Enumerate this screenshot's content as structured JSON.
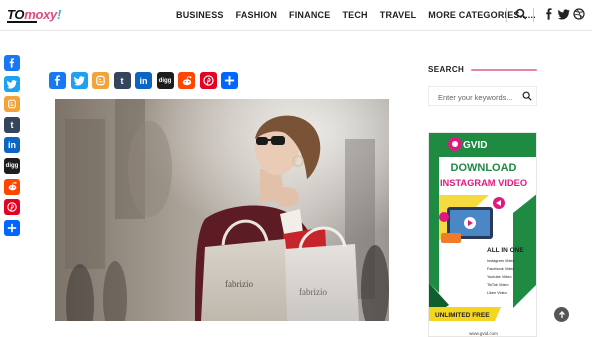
{
  "brand": {
    "logo_part1": "TO",
    "logo_part2": "moxy",
    "logo_part3": "!"
  },
  "nav": {
    "items": [
      "BUSINESS",
      "FASHION",
      "FINANCE",
      "TECH",
      "TRAVEL",
      "MORE CATEGORIES......"
    ]
  },
  "header_icons": [
    "search-icon",
    "facebook-icon",
    "twitter-icon",
    "dribbble-icon"
  ],
  "share": {
    "networks": [
      "Facebook",
      "Twitter",
      "Blogger",
      "Tumblr",
      "LinkedIn",
      "Digg",
      "Reddit",
      "Pinterest",
      "Share"
    ],
    "glyphs": {
      "tumblr": "t",
      "linkedin": "in",
      "digg": "digg"
    }
  },
  "sidebar": {
    "search_title": "SEARCH",
    "search_placeholder": "Enter your keywords..."
  },
  "ad": {
    "brand": "GVID",
    "line1": "DOWNLOAD",
    "line2": "INSTAGRAM VIDEO",
    "all_in_one": "ALL IN ONE",
    "list": [
      "Instagram Video",
      "Facebook Video",
      "Youtube Video",
      "TikTok Video",
      "Likee Video"
    ],
    "cta": "UNLIMITED FREE",
    "url": "www.gvid.com"
  },
  "colors": {
    "accent": "#e24b80",
    "ad_green": "#1f8a42",
    "ad_pink": "#e3187f",
    "ad_yellow": "#f4d51f"
  }
}
